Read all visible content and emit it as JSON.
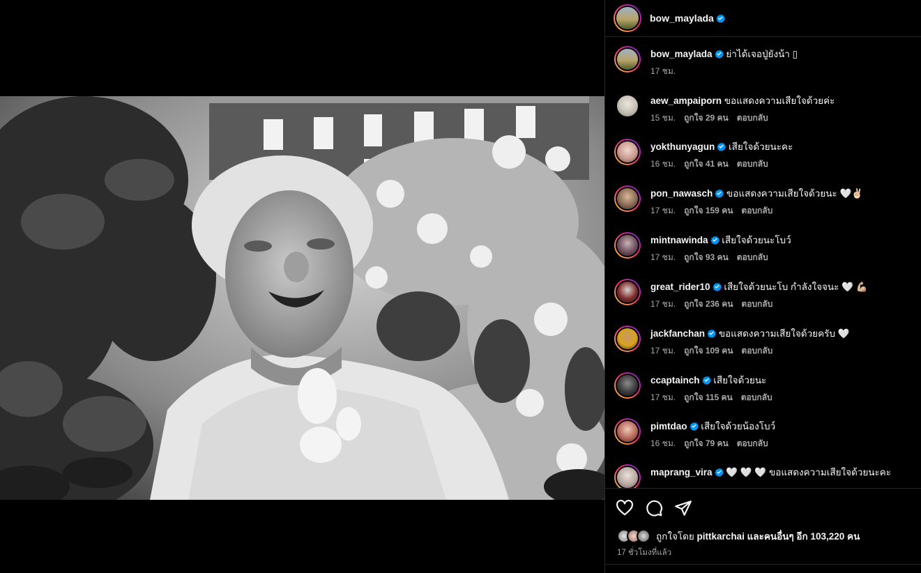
{
  "post": {
    "author": "bow_maylada",
    "caption": "ย่าได้เจอปู่ยังน้า",
    "caption_emoji": "▯",
    "caption_time": "17 ชม.",
    "likes_prefix": "ถูกใจโดย",
    "likes_user": "pittkarchai",
    "likes_middle": "และคนอื่นๆ อีก",
    "likes_count": "103,220",
    "likes_suffix": "คน",
    "time_ago": "17 ชั่วโมงที่แล้ว"
  },
  "labels": {
    "reply": "ตอบกลับ"
  },
  "comments": [
    {
      "user": "aew_ampaiporn",
      "verified": false,
      "text": "ขอแสดงความเสียใจด้วยค่ะ",
      "time": "15 ชม.",
      "likes": "ถูกใจ 29 คน"
    },
    {
      "user": "yokthunyagun",
      "verified": true,
      "text": "เสียใจด้วยนะคะ",
      "time": "16 ชม.",
      "likes": "ถูกใจ 41 คน"
    },
    {
      "user": "pon_nawasch",
      "verified": true,
      "text": "ขอแสดงความเสียใจด้วยนะ 🤍✌🏻",
      "time": "17 ชม.",
      "likes": "ถูกใจ 159 คน"
    },
    {
      "user": "mintnawinda",
      "verified": true,
      "text": "เสียใจด้วยนะโบว์",
      "time": "17 ชม.",
      "likes": "ถูกใจ 93 คน"
    },
    {
      "user": "great_rider10",
      "verified": true,
      "text": "เสียใจด้วยนะโบ กำลังใจจนะ 🤍 💪🏼",
      "time": "17 ชม.",
      "likes": "ถูกใจ 236 คน"
    },
    {
      "user": "jackfanchan",
      "verified": true,
      "text": "ขอแสดงความเสียใจด้วยครับ 🤍",
      "time": "17 ชม.",
      "likes": "ถูกใจ 109 คน"
    },
    {
      "user": "ccaptainch",
      "verified": true,
      "text": "เสียใจด้วยนะ",
      "time": "17 ชม.",
      "likes": "ถูกใจ 115 คน"
    },
    {
      "user": "pimtdao",
      "verified": true,
      "text": "เสียใจด้วยน้องโบว์",
      "time": "16 ชม.",
      "likes": "ถูกใจ 79 คน"
    },
    {
      "user": "maprang_vira",
      "verified": true,
      "text": "🤍 🤍 🤍 ขอแสดงความเสียใจด้วยนะคะ",
      "time": "",
      "likes": ""
    }
  ],
  "icons": [
    "like-heart-icon",
    "comment-bubble-icon",
    "share-plane-icon",
    "verified-badge-icon"
  ],
  "colors": {
    "background": "#000000",
    "verified": "#0095f6",
    "muted_text": "#a8a8a8",
    "divider": "#262626",
    "story_ring": [
      "#f9ce34",
      "#ee2a7b",
      "#6228d7"
    ]
  }
}
